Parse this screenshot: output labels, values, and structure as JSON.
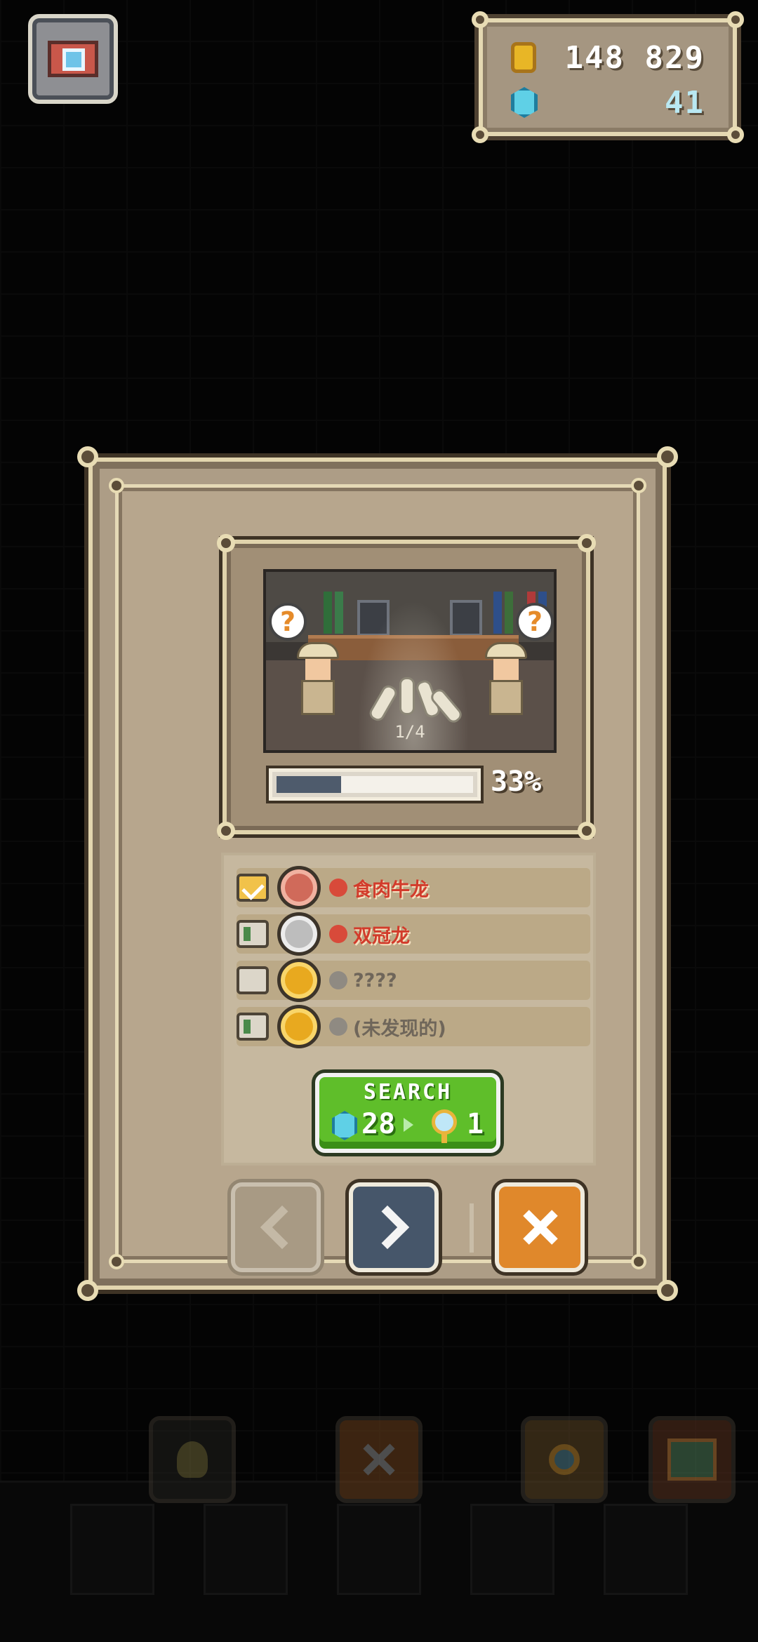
{
  "currency": {
    "gold_icon": "gold-coin-icon",
    "gold_value": "148 829",
    "gem_icon": "blue-gem-icon",
    "gem_value": "41"
  },
  "top_left": {
    "icon": "camera-icon"
  },
  "dialog": {
    "scene": {
      "page_label": "1/4",
      "left_marker": "?",
      "right_marker": "?"
    },
    "progress": {
      "percent_label": "33%",
      "value": 0.33
    },
    "items": [
      {
        "checked": true,
        "badge": "meat-badge",
        "badge_color": "red",
        "dot_color": "red",
        "label": "食肉牛龙"
      },
      {
        "checked": false,
        "badge": "fossil-badge",
        "badge_color": "gray",
        "dot_color": "red",
        "label": "双冠龙"
      },
      {
        "checked": false,
        "badge": "fossil-badge",
        "badge_color": "gold",
        "dot_color": "gray",
        "label": "????"
      },
      {
        "checked": false,
        "badge": "fossil-badge",
        "badge_color": "gold",
        "dot_color": "gray",
        "label": "(未发现的)"
      }
    ],
    "search_button": {
      "title": "SEARCH",
      "gem_cost": "28",
      "magnifier_cost": "1"
    },
    "nav": {
      "prev_icon": "chevron-left-icon",
      "next_icon": "chevron-right-icon",
      "close_icon": "close-icon"
    }
  },
  "toolbar": {
    "items": [
      "lightbulb-icon",
      "close-icon",
      "magnifier-question-icon",
      "map-icon"
    ]
  },
  "colors": {
    "dialog_bg": "#ad9d86",
    "search_green": "#5fbe2a",
    "close_orange": "#e0882b",
    "next_slate": "#46566a",
    "discovered_red": "#d23b2b"
  }
}
